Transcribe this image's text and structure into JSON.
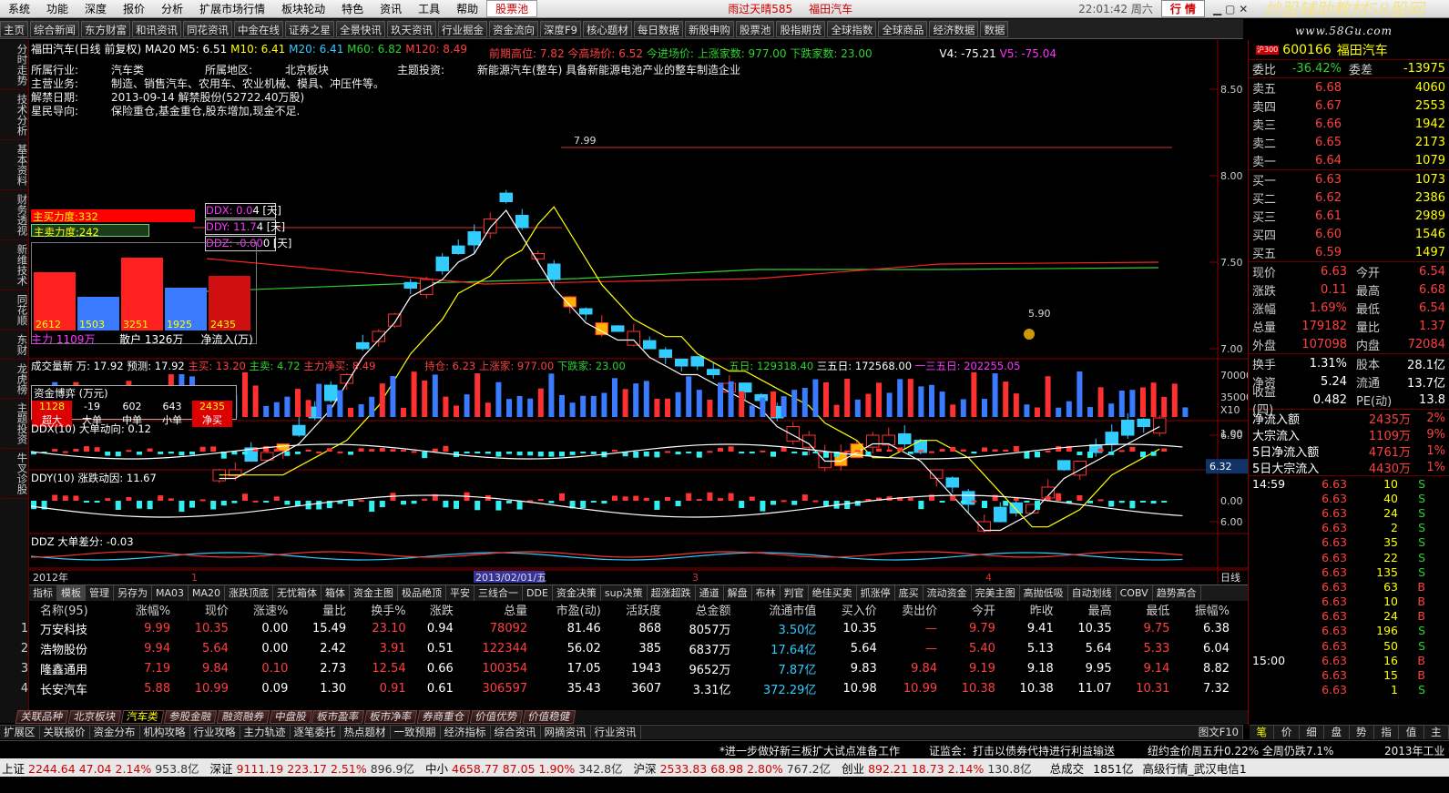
{
  "menu": {
    "items": [
      "系统",
      "功能",
      "深度",
      "报价",
      "分析",
      "扩展市场行情",
      "板块轮动",
      "特色",
      "资讯",
      "工具",
      "帮助"
    ],
    "stock_pool": "股票池",
    "marquee": "雨过天晴585",
    "marquee2": "福田汽车",
    "time": "22:01:42 周六",
    "trade": "行 情"
  },
  "watermark": {
    "line1": "炒股辅助教材58股网",
    "line2": "www.58Gu.com"
  },
  "toolbar": [
    "主页",
    "综合新闻",
    "东方财富",
    "和讯资讯",
    "同花资讯",
    "中金在线",
    "证券之星",
    "全景快讯",
    "玖天资讯",
    "行业掘金",
    "资金流向",
    "深度F9",
    "核心题材",
    "每日数据",
    "新股申购",
    "股票池",
    "股指期货",
    "全球指数",
    "全球商品",
    "经济数据",
    "数据"
  ],
  "left_tabs": [
    "分时走势",
    "技术分析",
    "基本资料",
    "财务透视",
    "新维技术",
    "同花顺",
    "东财",
    "龙虎榜",
    "主题投资",
    "牛叉诊股"
  ],
  "chart": {
    "title": "福田汽车(日线 前复权)",
    "ma20": "MA20",
    "m5": "M5: 6.51",
    "m10": "M10: 6.41",
    "m20": "M20: 6.41",
    "m60": "M60: 6.82",
    "m120": "M120: 8.49",
    "prev_high": "前期高位: 7.82",
    "today_close": "今高场价: 6.52",
    "today_in": "今进场价:",
    "up_count": "上涨家数: 977.00",
    "down_count": "下跌家数: 23.00",
    "v4": "V4: -75.21",
    "v5": "V5: -75.04",
    "info": [
      [
        "所属行业:",
        "汽车类",
        "所属地区:",
        "北京板块",
        "主题投资:",
        "新能源汽车(整车) 具备新能源电池产业的整车制造企业"
      ],
      [
        "主营业务:",
        "制造、销售汽车、农用车、农业机械、模具、冲压件等。"
      ],
      [
        "解禁日期:",
        "2013-09-14 解禁股份(52722.40万股)"
      ],
      [
        "星民导向:",
        "保险重仓,基金重仓,股东增加,现金不足."
      ]
    ],
    "y_labels": [
      "8.50",
      "8.00",
      "7.50",
      "7.00",
      "6.50",
      "6.00"
    ],
    "high_label": "7.99",
    "low_label": "5.90",
    "last_price": "6.32",
    "ddx_box": [
      "DDX: 0.0",
      "DDY: 11.7",
      "DDZ: -0.00"
    ],
    "ddx_box_tail": [
      "4 [天]",
      "4 [天]",
      "0 [天]"
    ],
    "force": {
      "buy_label": "主买力度:332",
      "sell_label": "主卖力度:242",
      "bars": [
        2612,
        1503,
        3251,
        1925,
        2435
      ],
      "bar_labels": [
        "2612",
        "1503",
        "3251",
        "1925",
        "2435"
      ],
      "legend": [
        "主力 1109万",
        "散户 1326万",
        "净流入(万)"
      ]
    },
    "vol_title": "成交量新 万: 17.92",
    "vol_pred": "预测: 17.92",
    "vol_main_buy": "主买: 13.20",
    "vol_main_sell": "主卖: 4.72",
    "vol_net": "主力净买: 8.49",
    "vol_hold": "持仓: 6.23",
    "vol_up": "上涨家: 977.00",
    "vol_down": "下跌家: 23.00",
    "vol_5": "五日: 129318.40",
    "vol_35": "三五日: 172568.00",
    "vol_135": "一三五日: 202255.05",
    "vol_y": [
      "70000",
      "35000",
      "X10"
    ],
    "fund_box": {
      "title": "资金博弈 (万元)",
      "vals": [
        "1128",
        "-19",
        "602",
        "643",
        "2435"
      ],
      "names": [
        "超大",
        "大单",
        "中单",
        "小单",
        "净买"
      ]
    },
    "ddx_title": "DDX(10) 大单动向: 0.12",
    "ddx_y": "1.00",
    "ddy_title": "DDY(10) 涨跌动因: 11.67",
    "ddy_y": "0.00",
    "ddz_title": "DDZ 大单差分: -0.03",
    "x_labels": [
      "2012年",
      "1",
      "2013/02/01/五",
      "3",
      "4"
    ],
    "period": "日线"
  },
  "ind_tabs": [
    "指标",
    "模板",
    "管理",
    "另存为",
    "MA03",
    "MA20",
    "涨跌顶底",
    "无忧箱体",
    "箱体",
    "资金主图",
    "极品绝顶",
    "平安",
    "三线合一",
    "DDE",
    "资金决策",
    "sup决策",
    "超涨超跌",
    "通道",
    "解盘",
    "布林",
    "判官",
    "绝佳买卖",
    "抓涨停",
    "底买",
    "流动资金",
    "完美主图",
    "高抛低吸",
    "自动划线",
    "COBV",
    "趋势高合"
  ],
  "table": {
    "headers": [
      "名称(95)",
      "涨幅%",
      "现价",
      "涨速%",
      "量比",
      "换手%",
      "涨跌",
      "总量",
      "市盈(动)",
      "活跃度",
      "总金额",
      "流通市值",
      "买入价",
      "卖出价",
      "今开",
      "昨收",
      "最高",
      "最低",
      "振幅%"
    ],
    "rows": [
      [
        "1",
        "万安科技",
        "9.99",
        "10.35",
        "0.00",
        "15.49",
        "23.10",
        "0.94",
        "78092",
        "81.46",
        "868",
        "8057万",
        "3.50亿",
        "10.35",
        "—",
        "9.79",
        "9.41",
        "10.35",
        "9.75",
        "6.38"
      ],
      [
        "2",
        "浩物股份",
        "9.94",
        "5.64",
        "0.00",
        "2.42",
        "3.91",
        "0.51",
        "122344",
        "56.02",
        "385",
        "6837万",
        "17.64亿",
        "5.64",
        "—",
        "5.40",
        "5.13",
        "5.64",
        "5.33",
        "6.04"
      ],
      [
        "3",
        "隆鑫通用",
        "7.19",
        "9.84",
        "0.10",
        "2.73",
        "12.54",
        "0.66",
        "100354",
        "17.05",
        "1943",
        "9652万",
        "7.87亿",
        "9.83",
        "9.84",
        "9.19",
        "9.18",
        "9.95",
        "9.14",
        "8.82"
      ],
      [
        "4",
        "长安汽车",
        "5.88",
        "10.99",
        "0.09",
        "1.30",
        "0.91",
        "0.61",
        "306597",
        "35.43",
        "3607",
        "3.31亿",
        "372.29亿",
        "10.98",
        "10.99",
        "10.38",
        "10.38",
        "11.07",
        "10.31",
        "7.32"
      ]
    ]
  },
  "section_tabs": [
    "关联品种",
    "北京板块",
    "汽车类",
    "参股金融",
    "融资融券",
    "中盘股",
    "板市盈率",
    "板市净率",
    "券商重仓",
    "价值优势",
    "价值稳健"
  ],
  "bottom_tabs": [
    "扩展区",
    "关联报价",
    "资金分布",
    "机构攻略",
    "行业攻略",
    "主力轨迹",
    "逐笔委托",
    "热点题材",
    "一致预期",
    "经济指标",
    "综合资讯",
    "网摘资讯",
    "行业资讯"
  ],
  "bottom_right": "图文F10",
  "news": [
    "*进一步做好新三板扩大试点准备工作",
    "证监会：打击以债券代持进行利益输送",
    "纽约金价周五升0.22% 全周仍跌7.1%",
    "2013年工业"
  ],
  "status": [
    [
      "上证",
      "2244.64",
      "47.04",
      "2.14%",
      "953.8亿"
    ],
    [
      "深证",
      "9111.19",
      "223.17",
      "2.51%",
      "896.9亿"
    ],
    [
      "中小",
      "4658.77",
      "87.05",
      "1.90%",
      "342.8亿"
    ],
    [
      "沪深",
      "2533.83",
      "68.98",
      "2.80%",
      "767.2亿"
    ],
    [
      "创业",
      "892.21",
      "18.73",
      "2.14%",
      "130.8亿"
    ]
  ],
  "status_tail": [
    "总成交",
    "1851亿",
    "高级行情_武汉电信1"
  ],
  "quote": {
    "code": "600166",
    "name": "福田汽车",
    "market": "沪300",
    "ratio_label": "委比",
    "ratio": "-36.42%",
    "diff_label": "委差",
    "diff": "-13975",
    "sells": [
      [
        "卖五",
        "6.68",
        "4060"
      ],
      [
        "卖四",
        "6.67",
        "2553"
      ],
      [
        "卖三",
        "6.66",
        "1942"
      ],
      [
        "卖二",
        "6.65",
        "2173"
      ],
      [
        "卖一",
        "6.64",
        "1079"
      ]
    ],
    "buys": [
      [
        "买一",
        "6.63",
        "1073"
      ],
      [
        "买二",
        "6.62",
        "2386"
      ],
      [
        "买三",
        "6.61",
        "2989"
      ],
      [
        "买四",
        "6.60",
        "1546"
      ],
      [
        "买五",
        "6.59",
        "1497"
      ]
    ],
    "stats": [
      [
        "现价",
        "6.63",
        "今开",
        "6.54"
      ],
      [
        "涨跌",
        "0.11",
        "最高",
        "6.68"
      ],
      [
        "涨幅",
        "1.69%",
        "最低",
        "6.54"
      ],
      [
        "总量",
        "179182",
        "量比",
        "1.37"
      ],
      [
        "外盘",
        "107098",
        "内盘",
        "72084"
      ]
    ],
    "stats2": [
      [
        "换手",
        "1.31%",
        "股本",
        "28.1亿"
      ],
      [
        "净资",
        "5.24",
        "流通",
        "13.7亿"
      ],
      [
        "收益(四)",
        "0.482",
        "PE(动)",
        "13.8"
      ]
    ],
    "flows": [
      [
        "净流入额",
        "2435万",
        "2%"
      ],
      [
        "大宗流入",
        "1109万",
        "9%"
      ],
      [
        "5日净流入额",
        "4761万",
        "1%"
      ],
      [
        "5日大宗流入",
        "4430万",
        "1%"
      ]
    ],
    "ticks": [
      [
        "14:59",
        "6.63",
        "10",
        "S"
      ],
      [
        "",
        "6.63",
        "40",
        "S"
      ],
      [
        "",
        "6.63",
        "24",
        "S"
      ],
      [
        "",
        "6.63",
        "2",
        "S"
      ],
      [
        "",
        "6.63",
        "35",
        "S"
      ],
      [
        "",
        "6.63",
        "22",
        "S"
      ],
      [
        "",
        "6.63",
        "135",
        "S"
      ],
      [
        "",
        "6.63",
        "63",
        "B"
      ],
      [
        "",
        "6.63",
        "10",
        "B"
      ],
      [
        "",
        "6.63",
        "24",
        "B"
      ],
      [
        "",
        "6.63",
        "196",
        "S"
      ],
      [
        "",
        "6.63",
        "50",
        "S"
      ],
      [
        "15:00",
        "6.63",
        "16",
        "B"
      ],
      [
        "",
        "6.63",
        "15",
        "B"
      ],
      [
        "",
        "6.63",
        "1",
        "S"
      ]
    ],
    "tabs": [
      "笔",
      "价",
      "细",
      "盘",
      "势",
      "指",
      "值",
      "主"
    ]
  }
}
